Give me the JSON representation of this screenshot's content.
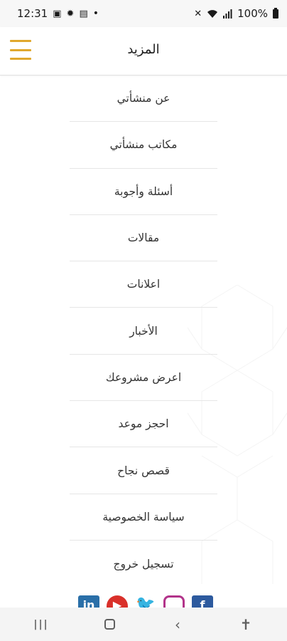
{
  "status_bar": {
    "time": "12:31",
    "battery_text": "100%",
    "icons": [
      "image-icon",
      "settings-icon",
      "notification-icon",
      "dot-icon",
      "mute-icon",
      "wifi-icon",
      "signal-icon",
      "battery-icon"
    ]
  },
  "header": {
    "title": "المزيد",
    "menu_icon": "hamburger-menu-icon",
    "accent_color": "#e0a82e"
  },
  "menu": {
    "items": [
      {
        "label": "عن منشأتي"
      },
      {
        "label": "مكاتب منشأتي"
      },
      {
        "label": "أسئلة وأجوبة"
      },
      {
        "label": "مقالات"
      },
      {
        "label": "اعلانات"
      },
      {
        "label": "الأخبار"
      },
      {
        "label": "اعرض مشروعك"
      },
      {
        "label": "احجز موعد"
      },
      {
        "label": "قصص نجاح"
      },
      {
        "label": "سياسة الخصوصية"
      },
      {
        "label": "تسجيل خروج"
      }
    ]
  },
  "social": {
    "icons": [
      "linkedin-icon",
      "youtube-icon",
      "twitter-icon",
      "instagram-icon",
      "facebook-icon"
    ]
  },
  "nav_bar": {
    "buttons": [
      "recents-icon",
      "home-icon",
      "back-icon",
      "accessibility-icon"
    ]
  }
}
